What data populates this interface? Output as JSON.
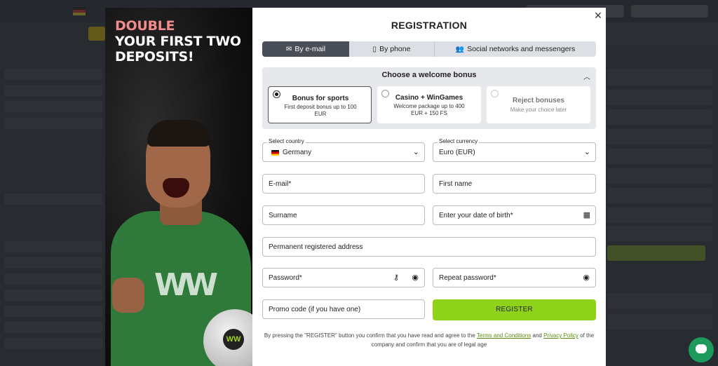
{
  "promo": {
    "headline_accent": "DOUBLE",
    "headline_rest": "YOUR FIRST TWO DEPOSITS!",
    "ball_mark": "WW"
  },
  "registration": {
    "title": "REGISTRATION",
    "close_label": "×",
    "tabs": [
      {
        "label": "By e-mail",
        "icon": "envelope-icon",
        "active": true
      },
      {
        "label": "By phone",
        "icon": "phone-icon",
        "active": false
      },
      {
        "label": "Social networks and messengers",
        "icon": "users-icon",
        "active": false
      }
    ],
    "bonus": {
      "title": "Choose a welcome bonus",
      "options": [
        {
          "title": "Bonus for sports",
          "subtitle": "First deposit bonus up to 100 EUR",
          "selected": true
        },
        {
          "title": "Casino + WinGames",
          "subtitle": "Welcome package up to 400 EUR + 150 FS",
          "selected": false
        },
        {
          "title": "Reject bonuses",
          "subtitle": "Make your choice later",
          "selected": false
        }
      ]
    },
    "country": {
      "label": "Select country",
      "value": "Germany"
    },
    "currency": {
      "label": "Select currency",
      "value": "Euro (EUR)"
    },
    "fields": {
      "email": "E-mail*",
      "first_name": "First name",
      "surname": "Surname",
      "dob": "Enter your date of birth*",
      "address": "Permanent registered address",
      "password": "Password*",
      "repeat_password": "Repeat password*",
      "promo_code": "Promo code (if you have one)"
    },
    "register_button": "REGISTER",
    "legal": {
      "text_1": "By pressing the \"REGISTER\" button you confirm that you have read and agree to the",
      "terms_link": "Terms and Conditions",
      "and": "and",
      "privacy_link": "Privacy Policy",
      "text_2": "of the company and confirm that you are of legal age"
    }
  },
  "colors": {
    "accent_green": "#8ed31a",
    "active_tab": "#4a4f57",
    "promo_accent": "#f28b8b",
    "link": "#5b8d10"
  }
}
